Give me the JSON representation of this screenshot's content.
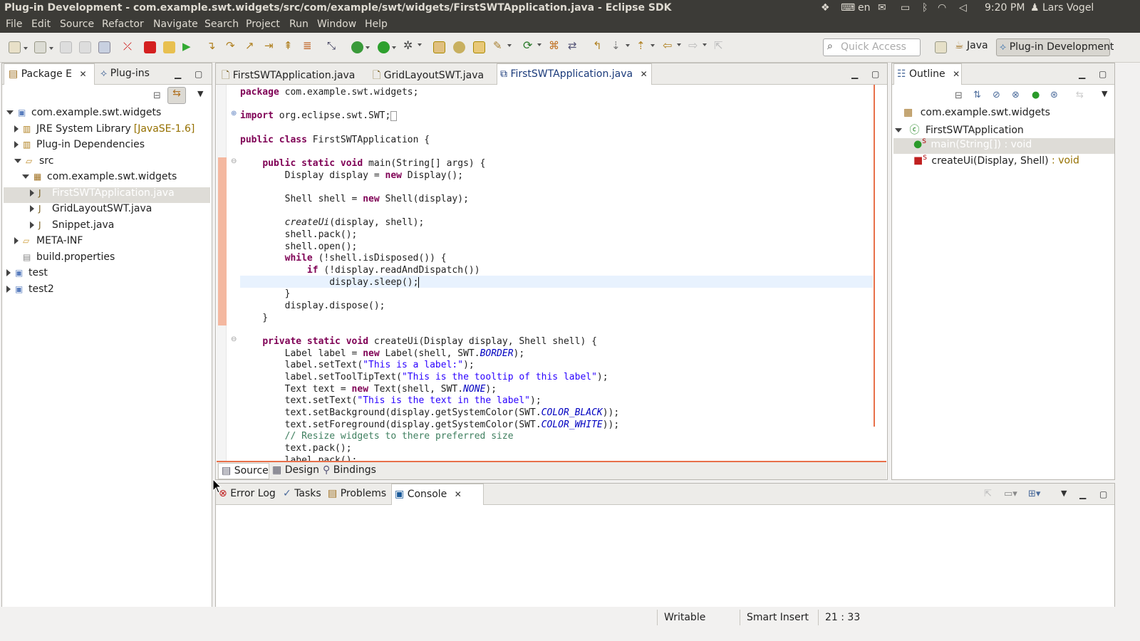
{
  "window_title": "Plug-in Development - com.example.swt.widgets/src/com/example/swt/widgets/FirstSWTApplication.java - Eclipse SDK",
  "tray": {
    "lang": "en",
    "time": "9:20 PM",
    "user": "Lars Vogel"
  },
  "menu": [
    "File",
    "Edit",
    "Source",
    "Refactor",
    "Navigate",
    "Search",
    "Project",
    "Run",
    "Window",
    "Help"
  ],
  "quick_access": {
    "placeholder": "Quick Access"
  },
  "perspectives": {
    "java": "Java",
    "plugin": "Plug-in Development"
  },
  "left_view": {
    "tabs": [
      "Package E",
      "Plug-ins"
    ],
    "tree": [
      {
        "label": "com.example.swt.widgets",
        "depth": 0,
        "open": true,
        "icon": "project"
      },
      {
        "label": "JRE System Library",
        "suffix": "[JavaSE-1.6]",
        "depth": 1,
        "open": false,
        "icon": "library"
      },
      {
        "label": "Plug-in Dependencies",
        "depth": 1,
        "open": false,
        "icon": "library"
      },
      {
        "label": "src",
        "depth": 1,
        "open": true,
        "icon": "src-folder"
      },
      {
        "label": "com.example.swt.widgets",
        "depth": 2,
        "open": true,
        "icon": "package"
      },
      {
        "label": "FirstSWTApplication.java",
        "depth": 3,
        "open": false,
        "icon": "java-file",
        "selected": true
      },
      {
        "label": "GridLayoutSWT.java",
        "depth": 3,
        "open": false,
        "icon": "java-file"
      },
      {
        "label": "Snippet.java",
        "depth": 3,
        "open": false,
        "icon": "java-file"
      },
      {
        "label": "META-INF",
        "depth": 1,
        "open": false,
        "icon": "folder"
      },
      {
        "label": "build.properties",
        "depth": 1,
        "open": null,
        "icon": "file"
      },
      {
        "label": "test",
        "depth": 0,
        "open": false,
        "icon": "project"
      },
      {
        "label": "test2",
        "depth": 0,
        "open": false,
        "icon": "project"
      }
    ]
  },
  "editor": {
    "tabs": [
      "FirstSWTApplication.java",
      "GridLayoutSWT.java",
      "FirstSWTApplication.java"
    ],
    "bottom_tabs": [
      "Source",
      "Design",
      "Bindings"
    ]
  },
  "outline": {
    "title": "Outline",
    "items": [
      {
        "label": "com.example.swt.widgets",
        "depth": 0
      },
      {
        "label": "FirstSWTApplication",
        "depth": 0,
        "open": true
      },
      {
        "label": "main(String[]) : void",
        "depth": 1,
        "selected": true
      },
      {
        "label": "createUi(Display, Shell)",
        "suffix": ": void",
        "depth": 1
      }
    ]
  },
  "bottom_view": {
    "tabs": [
      "Error Log",
      "Tasks",
      "Problems",
      "Console"
    ]
  },
  "status": {
    "writable": "Writable",
    "insert_mode": "Smart Insert",
    "position": "21 : 33"
  },
  "colors": {
    "keyword": "#7f0055",
    "string": "#2a00ff",
    "comment": "#3f7f5f",
    "constant": "#0000c0",
    "chrome_dark": "#3c3b37"
  }
}
